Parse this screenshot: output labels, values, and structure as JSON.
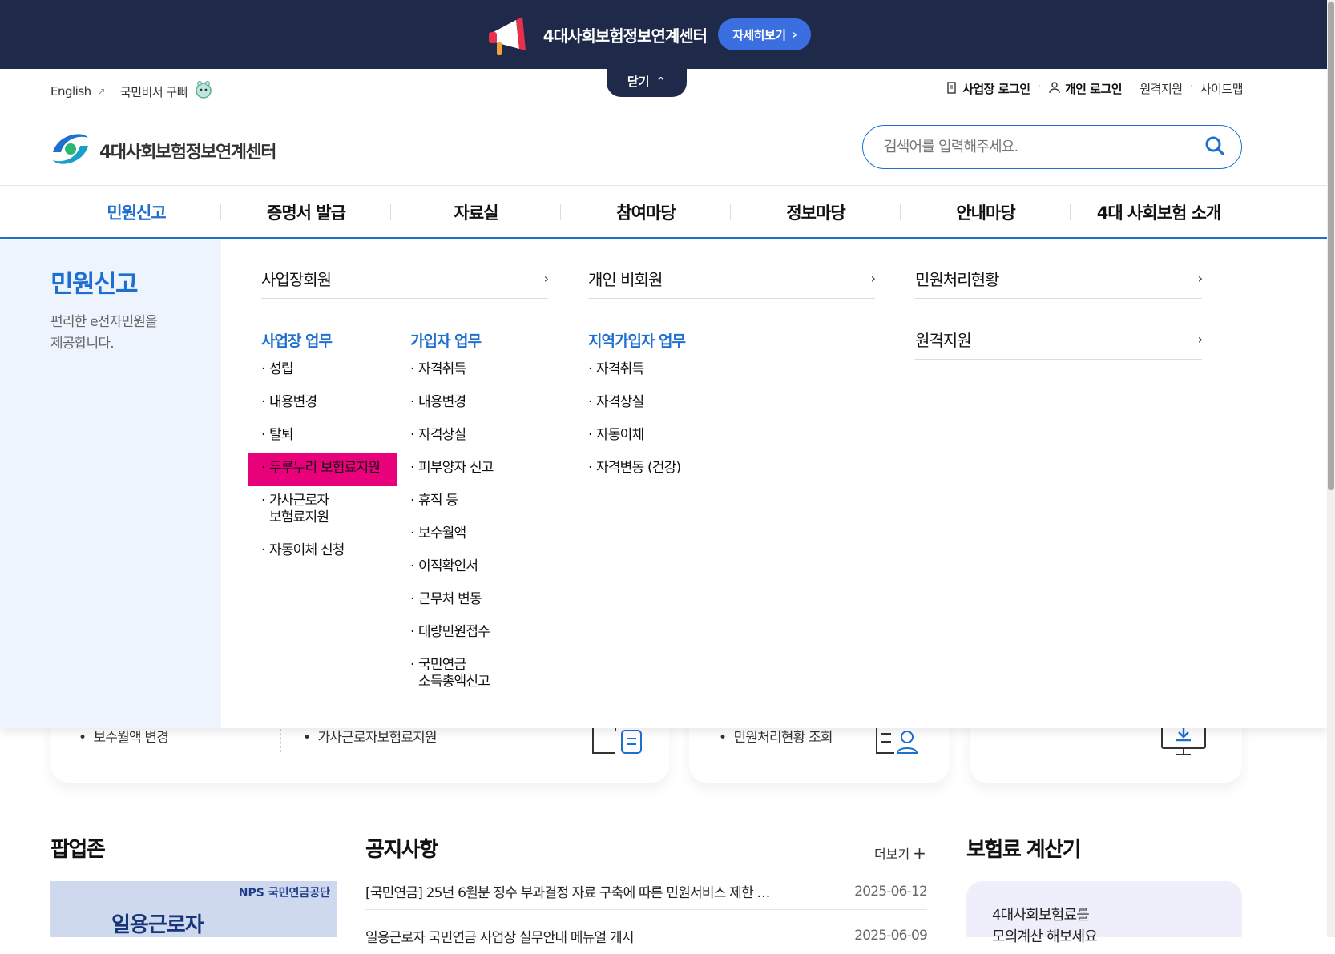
{
  "banner": {
    "title": "4대사회보험정보연계센터",
    "button": "자세히보기"
  },
  "close_tab": "닫기",
  "util": {
    "english": "English",
    "assistant": "국민비서 구삐",
    "business_login": "사업장 로그인",
    "personal_login": "개인 로그인",
    "remote": "원격지원",
    "sitemap": "사이트맵"
  },
  "logo": {
    "text": "4대사회보험정보연계센터"
  },
  "search": {
    "placeholder": "검색어를 입력해주세요."
  },
  "gnb": [
    "민원신고",
    "증명서 발급",
    "자료실",
    "참여마당",
    "정보마당",
    "안내마당",
    "4대 사회보험 소개"
  ],
  "mega": {
    "title": "민원신고",
    "desc_line1": "편리한 e전자민원을",
    "desc_line2": "제공합니다.",
    "col1_head": "사업장회원",
    "col2_head": "개인 비회원",
    "col3_head": "민원처리현황",
    "col3_head2": "원격지원",
    "biz_head": "사업장 업무",
    "biz_items": [
      "성립",
      "내용변경",
      "탈퇴",
      "두루누리 보험료지원",
      "가사근로자",
      "보험료지원",
      "자동이체 신청"
    ],
    "sub_head": "가입자 업무",
    "sub_items": [
      "자격취득",
      "내용변경",
      "자격상실",
      "피부양자 신고",
      "휴직 등",
      "보수월액",
      "이직확인서",
      "근무처 변동",
      "대량민원접수",
      "국민연금",
      "소득총액신고"
    ],
    "region_head": "지역가입자 업무",
    "region_items": [
      "자격취득",
      "자격상실",
      "자동이체",
      "자격변동 (건강)"
    ]
  },
  "cards": {
    "item1": "보수월액 변경",
    "item2": "가사근로자보험료지원",
    "item3": "민원처리현황 조회"
  },
  "sections": {
    "popup": "팝업존",
    "notice": "공지사항",
    "calc": "보험료 계산기",
    "more": "더보기"
  },
  "notices": [
    {
      "title": "[국민연금] 25년 6월분 징수 부과결정 자료 구축에 따른 민원서비스 제한 …",
      "date": "2025-06-12"
    },
    {
      "title": "일용근로자 국민연금 사업장 실무안내 메뉴얼 게시",
      "date": "2025-06-09"
    }
  ],
  "popup_img": {
    "brand": "NPS 국민연금공단",
    "text": "일용근로자"
  },
  "calc": {
    "line1": "4대사회보험료를",
    "line2": "모의계산 해보세요"
  },
  "colors": {
    "navy": "#1f2a4a",
    "blue": "#1f6fd1",
    "highlight": "#e9007b"
  }
}
